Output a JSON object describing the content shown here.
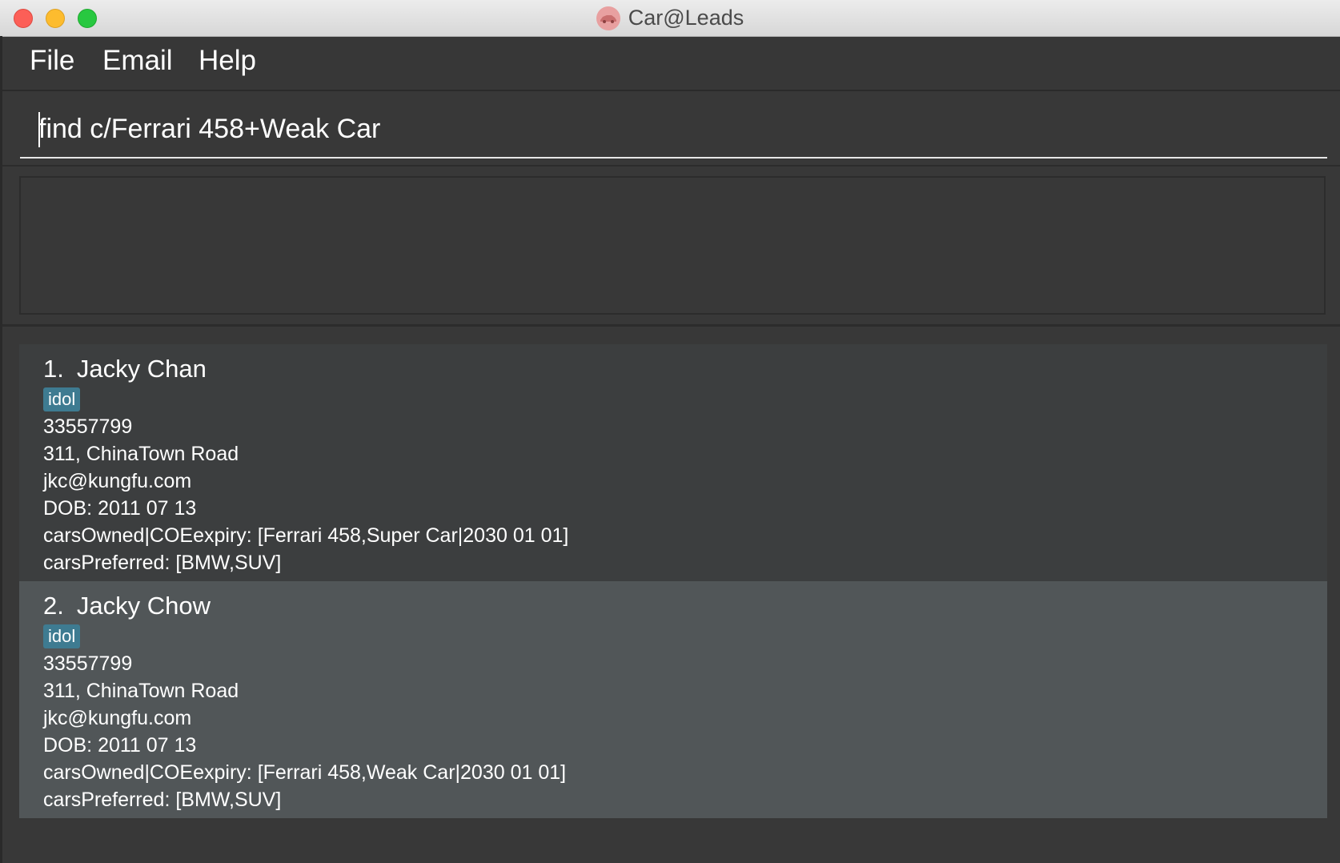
{
  "window": {
    "title": "Car@Leads",
    "buttons": {
      "close": "close",
      "minimize": "minimize",
      "maximize": "maximize"
    },
    "icon": "car-icon"
  },
  "menu": {
    "file": "File",
    "email": "Email",
    "help": "Help"
  },
  "command": {
    "value": "find c/Ferrari 458+Weak Car"
  },
  "result": {
    "text": ""
  },
  "persons": [
    {
      "index": "1.",
      "name": "Jacky Chan",
      "tag": "idol",
      "phone": "33557799",
      "address": "311, ChinaTown Road",
      "email": "jkc@kungfu.com",
      "dob": "DOB: 2011 07 13",
      "cars_owned": "carsOwned|COEexpiry: [Ferrari 458,Super Car|2030 01 01]",
      "cars_preferred": "carsPreferred: [BMW,SUV]"
    },
    {
      "index": "2.",
      "name": "Jacky Chow",
      "tag": "idol",
      "phone": "33557799",
      "address": "311, ChinaTown Road",
      "email": "jkc@kungfu.com",
      "dob": "DOB: 2011 07 13",
      "cars_owned": "carsOwned|COEexpiry: [Ferrari 458,Weak Car|2030 01 01]",
      "cars_preferred": "carsPreferred: [BMW,SUV]"
    }
  ],
  "colors": {
    "window_bg": "#383838",
    "card_odd": "#3c3e3f",
    "card_even": "#515658",
    "tag_bg": "#3e7b91"
  }
}
